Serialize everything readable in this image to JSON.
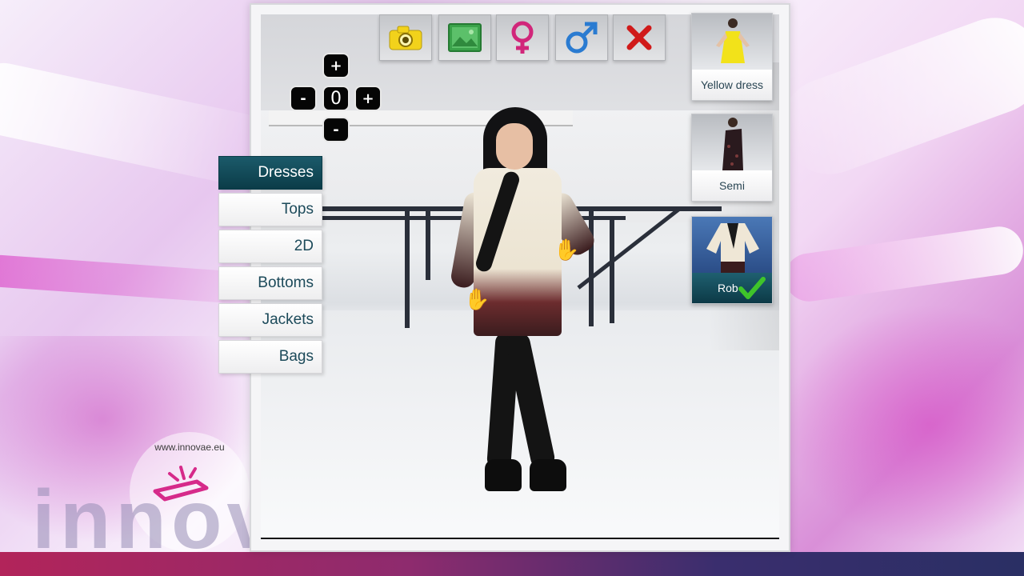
{
  "brand": {
    "url": "www.innovae.eu",
    "wordmark": "innova"
  },
  "toolbar": [
    {
      "name": "camera",
      "icon": "camera-icon",
      "color": "#f2d21b"
    },
    {
      "name": "gallery",
      "icon": "image-icon",
      "color": "#3aa24a"
    },
    {
      "name": "female",
      "icon": "female-symbol-icon",
      "color": "#d1267a"
    },
    {
      "name": "male",
      "icon": "male-symbol-icon",
      "color": "#2a7bd1"
    },
    {
      "name": "close",
      "icon": "close-icon",
      "color": "#d01a1a"
    }
  ],
  "zoom": {
    "plus_top": "+",
    "minus_left": "-",
    "value": "0",
    "plus_right": "+",
    "minus_bottom": "-"
  },
  "categories": [
    {
      "label": "Dresses",
      "active": true
    },
    {
      "label": "Tops",
      "active": false
    },
    {
      "label": "2D",
      "active": false
    },
    {
      "label": "Bottoms",
      "active": false
    },
    {
      "label": "Jackets",
      "active": false
    },
    {
      "label": "Bags",
      "active": false
    }
  ],
  "products": [
    {
      "label": "Yellow dress",
      "selected": false,
      "garment_color": "#f2e21a"
    },
    {
      "label": "Semi",
      "selected": false,
      "garment_color": "#2a1a1e"
    },
    {
      "label": "Rob",
      "selected": true,
      "garment_color": "#efe7d6"
    }
  ],
  "colors": {
    "active_tab": "#0b3c48",
    "tab_text": "#1c4a5a",
    "check": "#3fc42a",
    "accent_bar": "#b2245a"
  }
}
